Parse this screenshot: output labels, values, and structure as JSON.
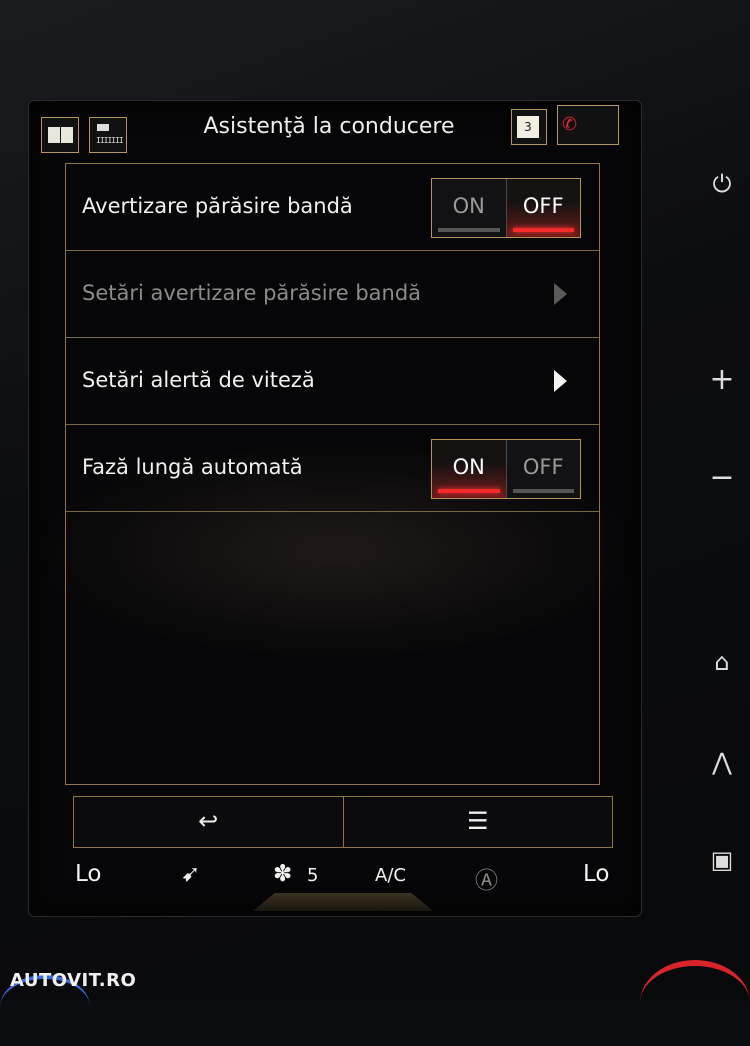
{
  "header": {
    "title": "Asistenţă la conducere",
    "notification_count": "3",
    "icons": [
      "book-icon",
      "radio-icon",
      "notification-icon",
      "phone-missed-icon"
    ]
  },
  "settings": [
    {
      "label": "Avertizare părăsire bandă",
      "type": "toggle",
      "on_label": "ON",
      "off_label": "OFF",
      "state": "off"
    },
    {
      "label": "Setări avertizare părăsire bandă",
      "type": "link",
      "enabled": false
    },
    {
      "label": "Setări alertă de viteză",
      "type": "link",
      "enabled": true
    },
    {
      "label": "Fază lungă automată",
      "type": "toggle",
      "on_label": "ON",
      "off_label": "OFF",
      "state": "on"
    }
  ],
  "bottom_bar": {
    "back_glyph": "↩",
    "menu_glyph": "☰"
  },
  "climate": {
    "left_temp": "Lo",
    "fan_speed": "5",
    "ac_label": "A/C",
    "auto_label": "Ⓐ",
    "right_temp": "Lo"
  },
  "side_buttons": [
    "power-icon",
    "plus-icon",
    "minus-icon",
    "home-icon",
    "navigation-icon",
    "display-icon"
  ],
  "side_glyphs": {
    "power": "⏻",
    "plus": "+",
    "minus": "−",
    "home": "⌂",
    "nav": "⋀",
    "display": "▣"
  },
  "watermark": "AUTOVIT.RO",
  "colors": {
    "accent_gold": "#b4975c",
    "active_red": "#f22a2a",
    "phone_red": "#e0263a"
  }
}
